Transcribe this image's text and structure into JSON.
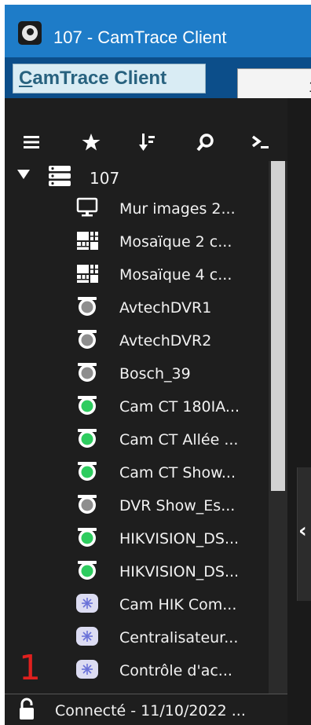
{
  "window": {
    "title": "107 - CamTrace Client"
  },
  "menu": {
    "app_button_prefix": "C",
    "app_button_rest": "amTrace Client",
    "tab_text": "1"
  },
  "toolbar": {
    "icons": [
      "menu-icon",
      "star-icon",
      "sort-icon",
      "search-icon",
      "terminal-icon"
    ]
  },
  "tree": {
    "root": {
      "label": "107",
      "icon": "server-icon",
      "expanded": true
    },
    "items": [
      {
        "label": "Mur images 2...",
        "icon": "monitor-icon"
      },
      {
        "label": "Mosaïque 2 c...",
        "icon": "mosaic-icon"
      },
      {
        "label": "Mosaïque 4 c...",
        "icon": "mosaic-icon"
      },
      {
        "label": "AvtechDVR1",
        "icon": "camera-icon",
        "status": "offline"
      },
      {
        "label": "AvtechDVR2",
        "icon": "camera-icon",
        "status": "offline"
      },
      {
        "label": "Bosch_39",
        "icon": "camera-icon",
        "status": "offline"
      },
      {
        "label": "Cam CT 180IA...",
        "icon": "camera-icon",
        "status": "online"
      },
      {
        "label": "Cam CT Allée ...",
        "icon": "camera-icon",
        "status": "online"
      },
      {
        "label": "Cam CT Show...",
        "icon": "camera-icon",
        "status": "online"
      },
      {
        "label": "DVR Show_Es...",
        "icon": "camera-icon",
        "status": "offline"
      },
      {
        "label": "HIKVISION_DS...",
        "icon": "camera-icon",
        "status": "online"
      },
      {
        "label": "HIKVISION_DS...",
        "icon": "camera-icon",
        "status": "online"
      },
      {
        "label": "Cam HIK Com...",
        "icon": "snowflake-icon"
      },
      {
        "label": "Centralisateur...",
        "icon": "snowflake-icon"
      },
      {
        "label": "Contrôle d'ac...",
        "icon": "snowflake-icon"
      }
    ]
  },
  "overlay": {
    "number": "1"
  },
  "status": {
    "text": "Connecté - 11/10/2022 ..."
  },
  "colors": {
    "titlebar": "#1e7cc8",
    "menubar": "#0c4e8a",
    "panel": "#1e1e1e",
    "online": "#2ecc5f",
    "offline": "#8e8e8e",
    "accent_red": "#e0201e",
    "snowflake_bg": "#dcdcf2",
    "snowflake_fg": "#6a72d8"
  }
}
